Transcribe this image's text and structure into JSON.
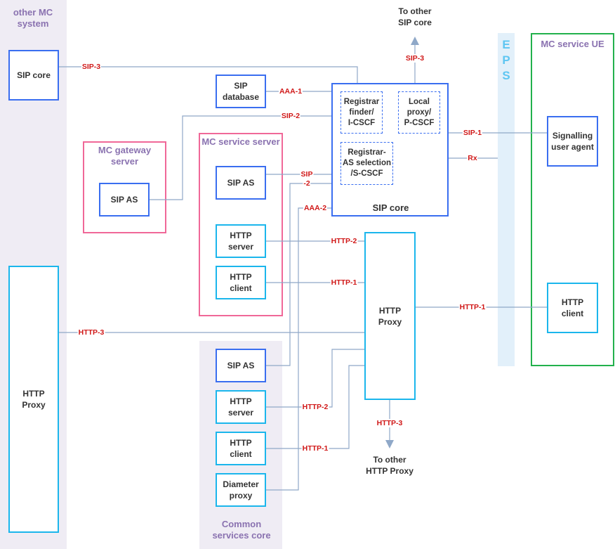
{
  "regions": {
    "other_mc_system": "other MC system",
    "common_services_core": "Common services core",
    "eps": [
      "E",
      "P",
      "S"
    ],
    "mc_service_ue": "MC service UE",
    "mc_gateway_server": "MC gateway server",
    "mc_service_server": "MC service server"
  },
  "nodes": {
    "other_sip_core": "SIP core",
    "other_http_proxy": [
      "HTTP",
      "Proxy"
    ],
    "sip_database": [
      "SIP",
      "database"
    ],
    "gateway_sip_as": "SIP AS",
    "service_sip_as": "SIP AS",
    "service_http_server": [
      "HTTP",
      "server"
    ],
    "service_http_client": [
      "HTTP",
      "client"
    ],
    "sip_core": "SIP core",
    "registrar_finder": [
      "Registrar",
      "finder/",
      "I-CSCF"
    ],
    "local_proxy": [
      "Local",
      "proxy/",
      "P-CSCF"
    ],
    "registrar_as": [
      "Registrar-",
      "AS selection",
      "/S-CSCF"
    ],
    "http_proxy": [
      "HTTP",
      "Proxy"
    ],
    "signalling_ua": [
      "Signalling",
      "user agent"
    ],
    "ue_http_client": [
      "HTTP",
      "client"
    ],
    "common_sip_as": "SIP AS",
    "common_http_server": [
      "HTTP",
      "server"
    ],
    "common_http_client": [
      "HTTP",
      "client"
    ],
    "diameter_proxy": [
      "Diameter",
      "proxy"
    ]
  },
  "destinations": {
    "to_other_sip_core": [
      "To other",
      "SIP core"
    ],
    "to_other_http_proxy": [
      "To other",
      "HTTP Proxy"
    ]
  },
  "links": {
    "sip3_other": "SIP-3",
    "sip3_up": "SIP-3",
    "aaa1": "AAA-1",
    "sip2_gateway": "SIP-2",
    "sip2_service_a": "SIP",
    "sip2_service_b": "-2",
    "aaa2": "AAA-2",
    "sip1": "SIP-1",
    "rx": "Rx",
    "http2_service": "HTTP-2",
    "http1_service": "HTTP-1",
    "http1_ue": "HTTP-1",
    "http3_other": "HTTP-3",
    "http2_common": "HTTP-2",
    "http1_common": "HTTP-1",
    "http3_down": "HTTP-3"
  }
}
